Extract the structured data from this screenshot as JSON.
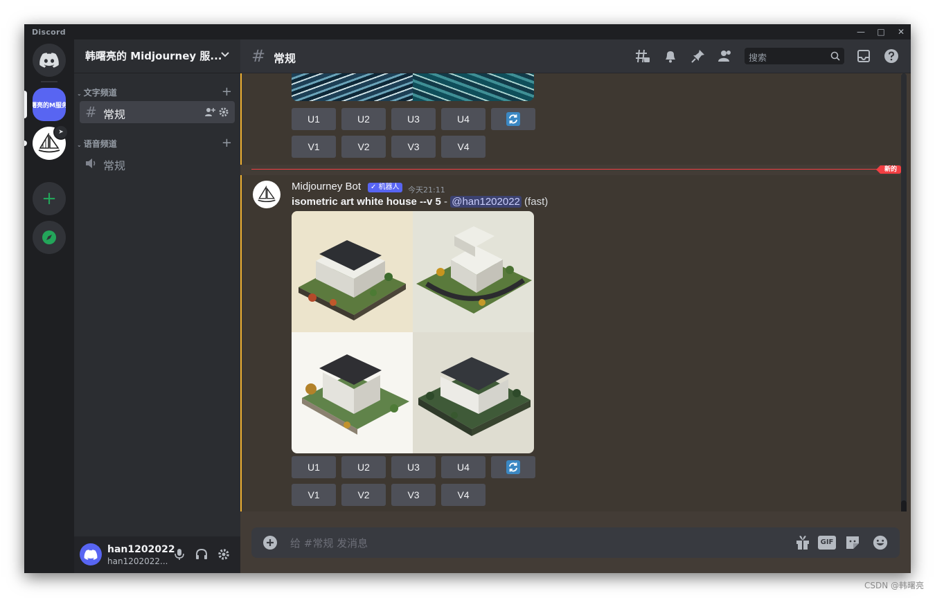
{
  "window": {
    "brand": "Discord"
  },
  "rail": {
    "active_server_label": "曙亮的M服务"
  },
  "sidebar": {
    "guild_name": "韩曙亮的 Midjourney 服...",
    "categories": [
      {
        "label": "文字频道",
        "channels": [
          {
            "label": "常规",
            "selected": true
          }
        ]
      },
      {
        "label": "语音频道",
        "channels": [
          {
            "label": "常规",
            "selected": false
          }
        ]
      }
    ],
    "user": {
      "name": "han1202022",
      "tag": "han1202022..."
    }
  },
  "header": {
    "channel_name": "常规",
    "search_placeholder": "搜索"
  },
  "messages": {
    "previous": {
      "upscale_buttons": [
        "U1",
        "U2",
        "U3",
        "U4"
      ],
      "variation_buttons": [
        "V1",
        "V2",
        "V3",
        "V4"
      ]
    },
    "new_divider_label": "新的",
    "current": {
      "author": "Midjourney Bot",
      "badge": "✓ 机器人",
      "timestamp": "今天21:11",
      "prompt_bold": "isometric art white house --v 5",
      "prompt_sep": " - ",
      "mention": "@han1202022",
      "mode": " (fast)",
      "upscale_buttons": [
        "U1",
        "U2",
        "U3",
        "U4"
      ],
      "variation_buttons": [
        "V1",
        "V2",
        "V3",
        "V4"
      ]
    }
  },
  "composer": {
    "placeholder": "给 #常规 发消息",
    "gif_label": "GIF"
  },
  "watermark": "CSDN @韩曙亮",
  "colors": {
    "blurple": "#5865f2",
    "mention_bar": "#f0b232",
    "new_red": "#f23f43",
    "green": "#23a55a"
  }
}
